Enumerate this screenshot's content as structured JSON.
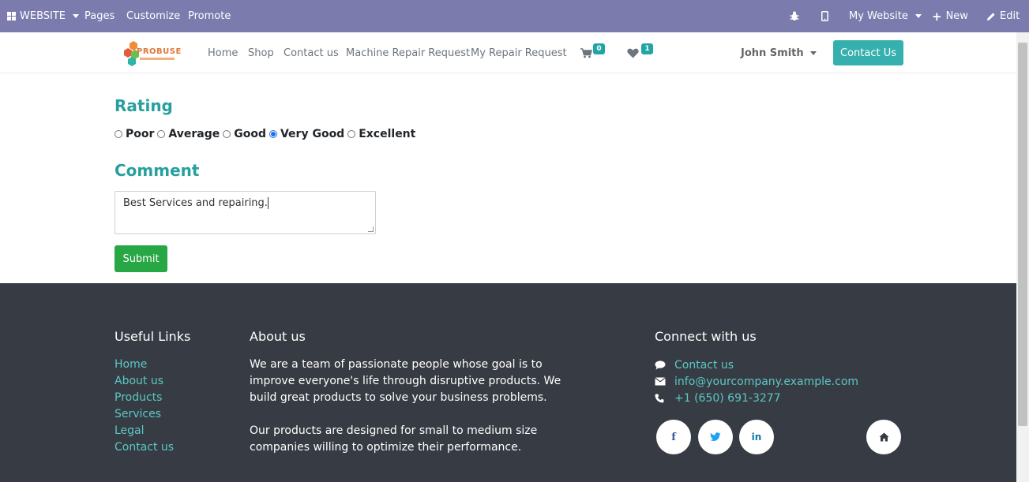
{
  "adminbar": {
    "website_label": "WEBSITE",
    "pages": "Pages",
    "customize": "Customize",
    "promote": "Promote",
    "my_website": "My Website",
    "new_label": "New",
    "edit_label": "Edit"
  },
  "header": {
    "logo_text": "PROBUSE",
    "nav": [
      "Home",
      "Shop",
      "Contact us",
      "Machine Repair Request",
      "My Repair Request"
    ],
    "cart_count": "0",
    "wishlist_count": "1",
    "user_name": "John Smith",
    "contact_button": "Contact Us"
  },
  "form": {
    "rating_title": "Rating",
    "rating_options": [
      "Poor",
      "Average",
      "Good",
      "Very Good",
      "Excellent"
    ],
    "selected_rating": "Very Good",
    "comment_title": "Comment",
    "comment_value": "Best Services and repairing.",
    "submit_label": "Submit"
  },
  "footer": {
    "useful_links_title": "Useful Links",
    "useful_links": [
      "Home",
      "About us",
      "Products",
      "Services",
      "Legal",
      "Contact us"
    ],
    "about_title": "About us",
    "about_p1": "We are a team of passionate people whose goal is to improve everyone's life through disruptive products. We build great products to solve your business problems.",
    "about_p2": "Our products are designed for small to medium size companies willing to optimize their performance.",
    "connect_title": "Connect with us",
    "contact_link": "Contact us",
    "email": "info@yourcompany.example.com",
    "phone": "+1 (650) 691-3277"
  },
  "colors": {
    "adminbar": "#7c7bad",
    "accent": "#35b0ae",
    "submit": "#28a745",
    "footer": "#373b43",
    "footer_link": "#5bc8c6"
  },
  "icons": {
    "adminbar": [
      "apps-grid-icon",
      "bug-icon",
      "mobile-icon",
      "plus-icon",
      "pencil-icon"
    ],
    "header": [
      "cart-icon",
      "heart-icon"
    ],
    "footer": [
      "comment-icon",
      "envelope-icon",
      "phone-icon",
      "facebook-icon",
      "twitter-icon",
      "linkedin-icon",
      "home-icon"
    ]
  }
}
